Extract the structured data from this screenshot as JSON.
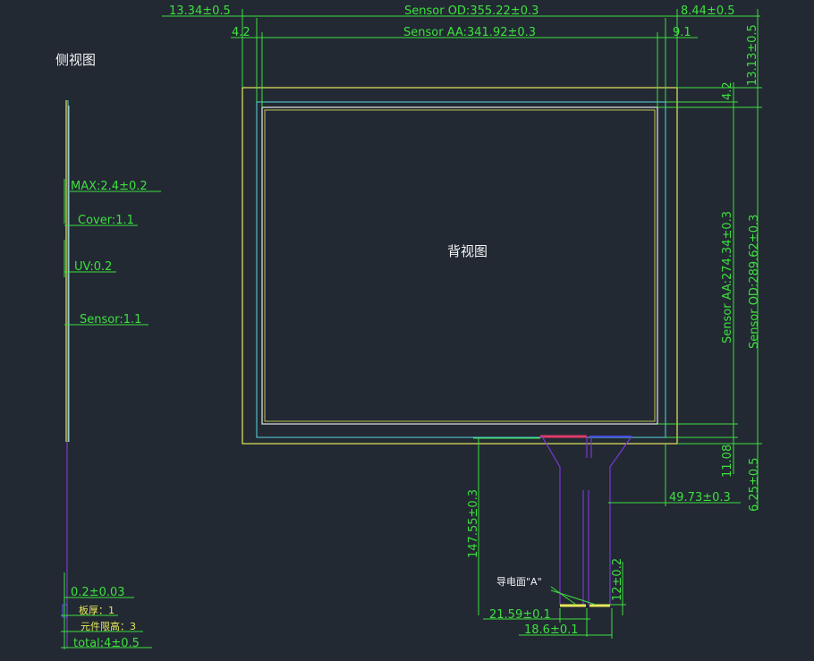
{
  "side_view": {
    "title": "侧视图",
    "max": "MAX:2.4±0.2",
    "cover": "Cover:1.1",
    "uv": "UV:0.2",
    "sensor": "Sensor:1.1",
    "fpc_thickness": "0.2±0.03",
    "board_thickness": "板厚：1",
    "component_height": "元件限高：3",
    "total": "total:4±0.5"
  },
  "back_view": {
    "title": "背视图",
    "left_margin": "13.34±0.5",
    "sensor_od_width": "Sensor OD:355.22±0.3",
    "right_margin": "8.44±0.5",
    "aa_left": "4.2",
    "sensor_aa_width": "Sensor AA:341.92±0.3",
    "aa_right": "9.1",
    "top_margin": "13.13±0.5",
    "aa_top": "4.2",
    "sensor_aa_height": "Sensor AA:274.34±0.3",
    "sensor_od_height": "Sensor OD:289.62±0.3",
    "aa_bottom": "11.08",
    "bottom_margin": "6.25±0.5"
  },
  "fpc": {
    "length": "147.55±0.3",
    "offset": "49.73±0.3",
    "tail_height": "12±0.2",
    "conductive_side": "导电面\"A\"",
    "width_outer": "21.59±0.1",
    "width_inner": "18.6±0.1"
  },
  "colors": {
    "background": "#222933",
    "dimension": "#3ee03e",
    "outline": "#e8e85a",
    "active_area": "#5ad6e0",
    "fpc": "#7a3ad0"
  }
}
